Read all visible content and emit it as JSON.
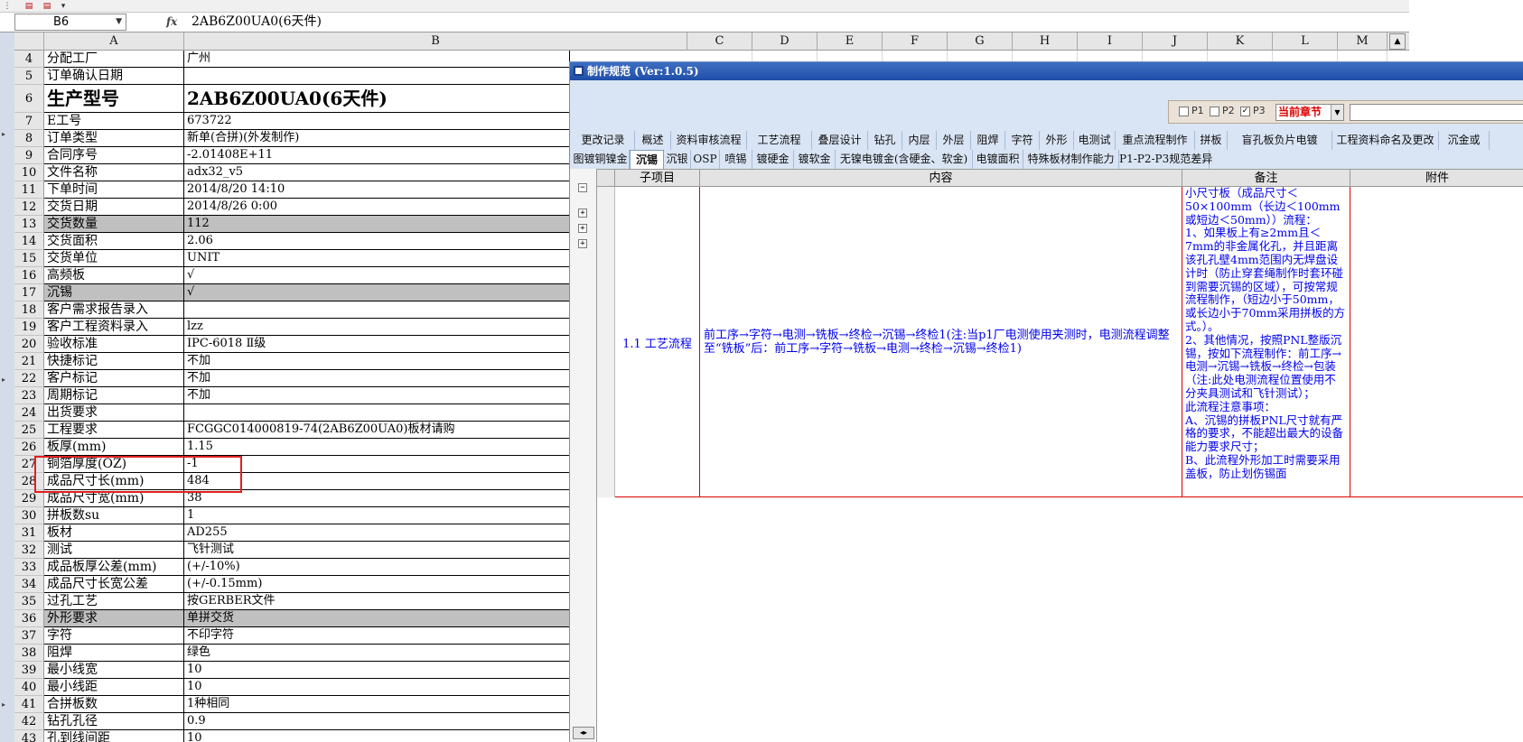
{
  "toolbar": {
    "items": [
      "pdf-icon",
      "pdf-icon",
      "more-icon"
    ]
  },
  "formula_bar": {
    "cell_ref": "B6",
    "fx": "fx",
    "value": "2AB6Z00UA0(6天件)"
  },
  "columns": [
    "A",
    "B",
    "C",
    "D",
    "E",
    "F",
    "G",
    "H",
    "I",
    "J",
    "K",
    "L",
    "M"
  ],
  "rows": [
    {
      "n": "4",
      "a": "分配工厂",
      "b": "广州"
    },
    {
      "n": "5",
      "a": "订单确认日期",
      "b": ""
    },
    {
      "n": "6",
      "a": "生产型号",
      "b": "2AB6Z00UA0(6天件)"
    },
    {
      "n": "7",
      "a": "E工号",
      "b": "673722"
    },
    {
      "n": "8",
      "a": "订单类型",
      "b": "新单(合拼)(外发制作)"
    },
    {
      "n": "9",
      "a": "合同序号",
      "b": "-2.01408E+11"
    },
    {
      "n": "10",
      "a": "文件名称",
      "b": "adx32_v5"
    },
    {
      "n": "11",
      "a": "下单时间",
      "b": "2014/8/20 14:10"
    },
    {
      "n": "12",
      "a": "交货日期",
      "b": "2014/8/26 0:00"
    },
    {
      "n": "13",
      "a": "交货数量",
      "b": "112"
    },
    {
      "n": "14",
      "a": "交货面积",
      "b": "2.06"
    },
    {
      "n": "15",
      "a": "交货单位",
      "b": "UNIT"
    },
    {
      "n": "16",
      "a": "高频板",
      "b": "√"
    },
    {
      "n": "17",
      "a": "沉锡",
      "b": "√"
    },
    {
      "n": "18",
      "a": "客户需求报告录入",
      "b": ""
    },
    {
      "n": "19",
      "a": "客户工程资料录入",
      "b": "lzz"
    },
    {
      "n": "20",
      "a": "验收标准",
      "b": "IPC-6018 Ⅱ级"
    },
    {
      "n": "21",
      "a": "快捷标记",
      "b": "不加"
    },
    {
      "n": "22",
      "a": "客户标记",
      "b": "不加"
    },
    {
      "n": "23",
      "a": "周期标记",
      "b": "不加"
    },
    {
      "n": "24",
      "a": "出货要求",
      "b": ""
    },
    {
      "n": "25",
      "a": "工程要求",
      "b": "FCGGC014000819-74(2AB6Z00UA0)板材请购"
    },
    {
      "n": "26",
      "a": "板厚(mm)",
      "b": "1.15"
    },
    {
      "n": "27",
      "a": "铜箔厚度(OZ)",
      "b": "-1"
    },
    {
      "n": "28",
      "a": "成品尺寸长(mm)",
      "b": "484"
    },
    {
      "n": "29",
      "a": "成品尺寸宽(mm)",
      "b": "38"
    },
    {
      "n": "30",
      "a": "拼板数su",
      "b": "1"
    },
    {
      "n": "31",
      "a": "板材",
      "b": "AD255"
    },
    {
      "n": "32",
      "a": "测试",
      "b": "飞针测试"
    },
    {
      "n": "33",
      "a": "成品板厚公差(mm)",
      "b": "(+/-10%)"
    },
    {
      "n": "34",
      "a": "成品尺寸长宽公差",
      "b": "(+/-0.15mm)"
    },
    {
      "n": "35",
      "a": "过孔工艺",
      "b": "按GERBER文件"
    },
    {
      "n": "36",
      "a": "外形要求",
      "b": "单拼交货"
    },
    {
      "n": "37",
      "a": "字符",
      "b": "不印字符"
    },
    {
      "n": "38",
      "a": "阻焊",
      "b": "绿色"
    },
    {
      "n": "39",
      "a": "最小线宽",
      "b": "10"
    },
    {
      "n": "40",
      "a": "最小线距",
      "b": "10"
    },
    {
      "n": "41",
      "a": "合拼板数",
      "b": "1种相同"
    },
    {
      "n": "42",
      "a": "钻孔孔径",
      "b": "0.9"
    },
    {
      "n": "43",
      "a": "孔到线间距",
      "b": "10"
    }
  ],
  "dialog": {
    "title": "制作规范 (Ver:1.0.5)",
    "filter": {
      "p1": "P1",
      "p2": "P2",
      "p3": "P3",
      "p3_checked": "✓",
      "chapter": "当前章节"
    },
    "tabs_row1": [
      "更改记录",
      "概述",
      "资料审核流程",
      "工艺流程",
      "叠层设计",
      "钻孔",
      "内层",
      "外层",
      "阻焊",
      "字符",
      "外形",
      "电测试",
      "重点流程制作",
      "拼板",
      "盲孔板负片电镀",
      "工程资料命名及更改",
      "沉金或"
    ],
    "tabs_row2": [
      "图镀铜镍金",
      "沉锡",
      "沉银",
      "OSP",
      "喷锡",
      "镀硬金",
      "镀软金",
      "无镍电镀金(含硬金、软金)",
      "电镀面积",
      "特殊板材制作能力",
      "P1-P2-P3规范差异"
    ],
    "active_tab": "沉锡",
    "table_headers": [
      "子项目",
      "内容",
      "备注",
      "附件"
    ],
    "record": {
      "sub_item": "1.1 工艺流程",
      "content": "前工序→字符→电测→铣板→终检→沉锡→终检1(注:当p1厂电测使用夹测时，电测流程调整至“铣板”后：前工序→字符→铣板→电测→终检→沉锡→终检1)",
      "note": "小尺寸板（成品尺寸＜50×100mm（长边＜100mm或短边＜50mm））流程：\n1、如果板上有≥2mm且＜7mm的非金属化孔，并且距离该孔孔壁4mm范围内无焊盘设计时（防止穿套绳制作时套环碰到需要沉锡的区域），可按常规流程制作，（短边小于50mm，或长边小于70mm采用拼板的方式。）。\n2、其他情况，按照PNL整版沉锡，按如下流程制作：前工序→电测→沉锡→铣板→终检→包装（注:此处电测流程位置使用不分夹具测试和飞针测试）；\n此流程注意事项：\nA、沉锡的拼板PNL尺寸就有严格的要求，不能超出最大的设备能力要求尺寸；\nB、此流程外形加工时需要采用盖板，防止划伤锡面",
      "attachment": ""
    }
  }
}
